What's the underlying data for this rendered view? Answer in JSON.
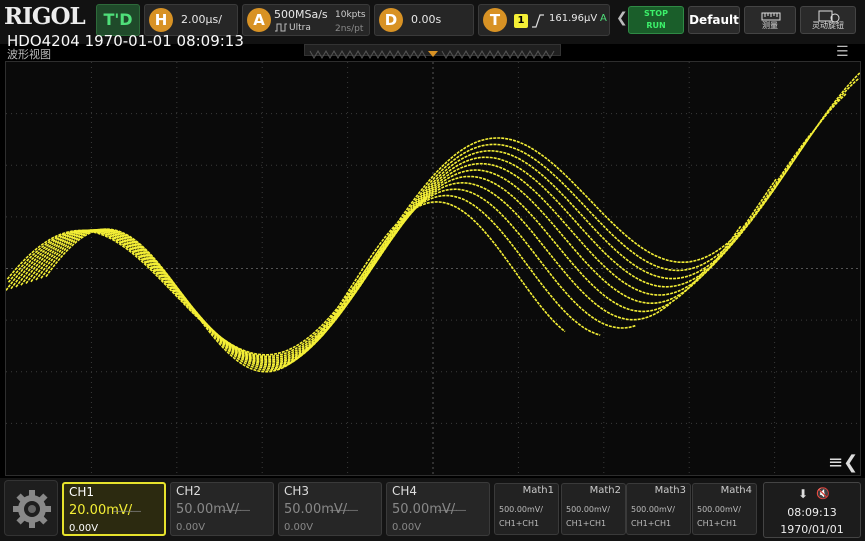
{
  "topbar": {
    "logo": "RIGOL",
    "mode": "T'D",
    "horizontal": {
      "icon": "H",
      "scale": "2.00μs/"
    },
    "acquire": {
      "icon": "A",
      "sample_rate": "500MSa/s",
      "mode": "Ultra",
      "memory": "10kpts",
      "sample_interval": "2ns/pt"
    },
    "delay": {
      "icon": "D",
      "value": "0.00s"
    },
    "trigger": {
      "icon": "T",
      "source": "1",
      "level": "161.96μV",
      "mode": "A"
    },
    "run_state": {
      "line1": "STOP",
      "line2": "RUN"
    },
    "default_label": "Default",
    "measure_label": "测量",
    "display_label": "灵动旋钮"
  },
  "header": {
    "model_time": "HDO4204 1970-01-01 08:09:13",
    "view_title": "波形视图"
  },
  "channels": [
    {
      "name": "CH1",
      "scale": "20.00mV/",
      "offset": "0.00V",
      "active": true,
      "color": "#f4ef36"
    },
    {
      "name": "CH2",
      "scale": "50.00mV/",
      "offset": "0.00V",
      "active": false
    },
    {
      "name": "CH3",
      "scale": "50.00mV/",
      "offset": "0.00V",
      "active": false
    },
    {
      "name": "CH4",
      "scale": "50.00mV/",
      "offset": "0.00V",
      "active": false
    }
  ],
  "math": [
    {
      "name": "Math1",
      "scale": "500.00mV/",
      "source": "CH1+CH1"
    },
    {
      "name": "Math2",
      "scale": "500.00mV/",
      "source": "CH1+CH1"
    },
    {
      "name": "Math3",
      "scale": "500.00mV/",
      "source": "CH1+CH1"
    },
    {
      "name": "Math4",
      "scale": "500.00mV/",
      "source": "CH1+CH1"
    }
  ],
  "status": {
    "time": "08:09:13",
    "date": "1970/01/01"
  },
  "colors": {
    "trace": "#f4ef36",
    "accent": "#d89224",
    "run_green": "#3cf06a"
  },
  "icons": {
    "gear": "gear-icon",
    "usb": "usb-icon",
    "speaker": "speaker-muted-icon",
    "menu": "menu-icon",
    "collapse": "collapse-menu-icon",
    "measure": "ruler-icon",
    "display": "knob-icon",
    "trigger_edge": "rising-edge-icon"
  }
}
